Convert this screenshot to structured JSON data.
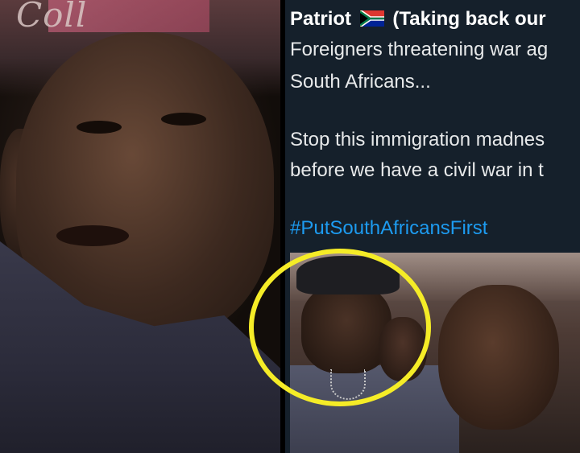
{
  "left_photo": {
    "sign_text": "Coll"
  },
  "tweet": {
    "author_name": "Patriot",
    "flag_icon": "south-africa-flag-icon",
    "author_suffix": "(Taking back our",
    "lines": [
      "Foreigners threatening war ag",
      "South Africans...",
      "Stop this immigration madnes",
      "before we have a civil war in t"
    ],
    "hashtag": "#PutSouthAfricansFirst"
  },
  "colors": {
    "tweet_background": "#15202b",
    "hashtag": "#1d9bf0",
    "highlight_circle": "#f5ec27"
  }
}
